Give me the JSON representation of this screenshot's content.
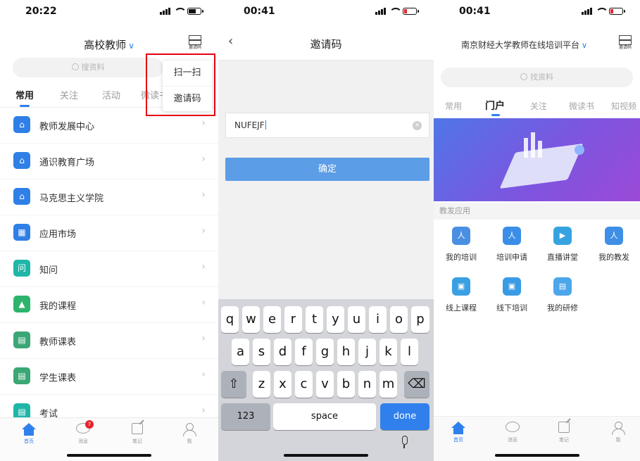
{
  "colors": {
    "accent": "#2f80ed",
    "highlight_box": "#e60012",
    "badge": "#e8232d"
  },
  "panel1": {
    "time": "20:22",
    "title": "高校教师",
    "title_chevron": "∨",
    "scan_caption": "邀请码",
    "search_placeholder": "搜资料",
    "tabs": [
      "常用",
      "关注",
      "活动",
      "微读书"
    ],
    "popup_menu": [
      "扫一扫",
      "邀请码"
    ],
    "list": [
      {
        "label": "教师发展中心",
        "icon": "home-icon",
        "glyph": "⌂"
      },
      {
        "label": "通识教育广场",
        "icon": "home-icon",
        "glyph": "⌂"
      },
      {
        "label": "马克思主义学院",
        "icon": "home-icon",
        "glyph": "⌂"
      },
      {
        "label": "应用市场",
        "icon": "grid-icon",
        "glyph": "▦"
      },
      {
        "label": "知问",
        "icon": "qa-icon",
        "glyph": "问"
      },
      {
        "label": "我的课程",
        "icon": "graduation-cap-icon",
        "glyph": "▲"
      },
      {
        "label": "教师课表",
        "icon": "calendar-icon",
        "glyph": "▤"
      },
      {
        "label": "学生课表",
        "icon": "calendar-icon",
        "glyph": "▤"
      },
      {
        "label": "考试",
        "icon": "exam-icon",
        "glyph": "▤"
      }
    ],
    "arrow": "›",
    "tabbar": [
      {
        "label": "首页",
        "icon": "home-icon"
      },
      {
        "label": "消息",
        "icon": "message-icon",
        "badge": "7"
      },
      {
        "label": "笔记",
        "icon": "note-icon"
      },
      {
        "label": "我",
        "icon": "profile-icon"
      }
    ]
  },
  "panel2": {
    "time": "00:41",
    "back": "‹",
    "title": "邀请码",
    "code_value": "NUFEJF",
    "clear_glyph": "×",
    "confirm_label": "确定",
    "keyboard": {
      "row1": [
        "q",
        "w",
        "e",
        "r",
        "t",
        "y",
        "u",
        "i",
        "o",
        "p"
      ],
      "row2": [
        "a",
        "s",
        "d",
        "f",
        "g",
        "h",
        "j",
        "k",
        "l"
      ],
      "row3": [
        "z",
        "x",
        "c",
        "v",
        "b",
        "n",
        "m"
      ],
      "shift": "⇧",
      "delete": "⌫",
      "numbers": "123",
      "space": "space",
      "done": "done"
    }
  },
  "panel3": {
    "time": "00:41",
    "title": "南京财经大学教师在线培训平台",
    "title_chevron": "∨",
    "scan_caption": "邀请码",
    "search_placeholder": "找资料",
    "tabs": [
      "常用",
      "门户",
      "关注",
      "微读书",
      "知视频"
    ],
    "section_title": "教发应用",
    "apps": [
      {
        "label": "我的培训",
        "color": "#4a90e2",
        "glyph": "人"
      },
      {
        "label": "培训申请",
        "color": "#3b8ee8",
        "glyph": "人"
      },
      {
        "label": "直播讲堂",
        "color": "#36a3e0",
        "glyph": "▶"
      },
      {
        "label": "我的教发",
        "color": "#3f8fe6",
        "glyph": "人"
      },
      {
        "label": "线上课程",
        "color": "#3aa0e3",
        "glyph": "▣"
      },
      {
        "label": "线下培训",
        "color": "#3a9be5",
        "glyph": "▣"
      },
      {
        "label": "我的研修",
        "color": "#4ca6ea",
        "glyph": "▤"
      }
    ],
    "tabbar": [
      {
        "label": "首页",
        "icon": "home-icon"
      },
      {
        "label": "消息",
        "icon": "message-icon"
      },
      {
        "label": "笔记",
        "icon": "note-icon"
      },
      {
        "label": "我",
        "icon": "profile-icon"
      }
    ]
  }
}
